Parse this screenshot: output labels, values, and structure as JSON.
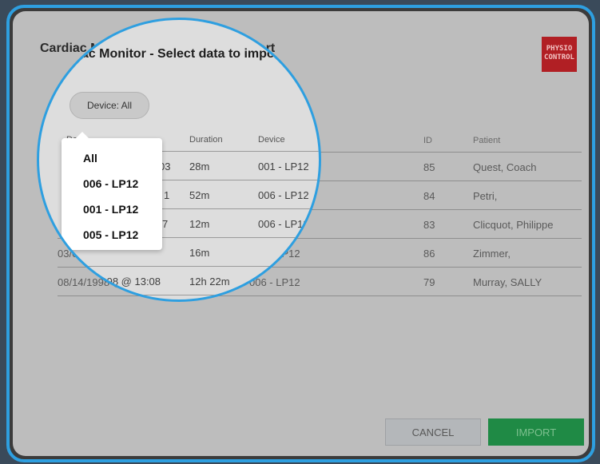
{
  "dialog": {
    "title": "Cardiac Monitor - Select data to import",
    "logo_text": "PHYSIO\nCONTROL",
    "filter_label": "Device: All"
  },
  "table": {
    "headers": {
      "date": "Date",
      "duration": "Duration",
      "device": "Device",
      "id": "ID",
      "patient": "Patient"
    },
    "rows": [
      {
        "date": "03",
        "duration": "28m",
        "device": "001 - LP12",
        "id": "85",
        "patient": "Quest, Coach"
      },
      {
        "date": "1",
        "duration": "52m",
        "device": "006 - LP12",
        "id": "84",
        "patient": "Petri,"
      },
      {
        "date": "7",
        "duration": "12m",
        "device": "006 - LP12",
        "id": "83",
        "patient": "Clicquot, Philippe"
      },
      {
        "date": "03/06/2003 @ 8:03",
        "duration": "16m",
        "device": "005 - LP12",
        "id": "86",
        "patient": "Zimmer,"
      },
      {
        "date": "08/14/1998 @ 13:08",
        "duration": "12h 22m",
        "device": "006 - LP12",
        "id": "79",
        "patient": "Murray, SALLY"
      }
    ]
  },
  "dropdown": {
    "items": [
      "All",
      "006 - LP12",
      "001 - LP12",
      "005 - LP12"
    ]
  },
  "buttons": {
    "cancel": "CANCEL",
    "import": "IMPORT"
  },
  "colors": {
    "frame_border": "#2e9fe0",
    "import_button": "#1f8a45",
    "logo_bg": "#b11f24"
  }
}
